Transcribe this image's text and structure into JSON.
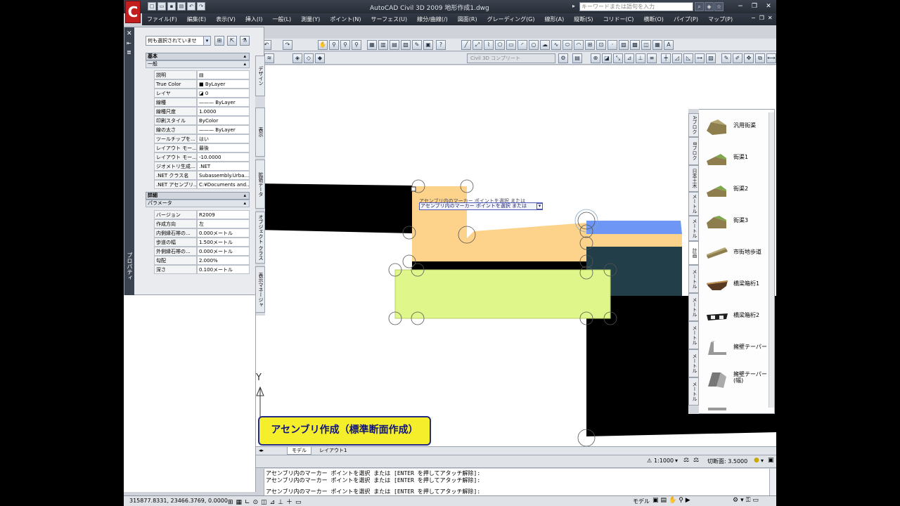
{
  "app": {
    "title": "AutoCAD Civil 3D 2009   地形作成1.dwg",
    "logo": "C",
    "search_placeholder": "キーワードまたは語句を入力",
    "window_buttons": [
      "−",
      "❐",
      "✕"
    ],
    "doc_buttons": [
      "−",
      "❐",
      "✕"
    ]
  },
  "menu": [
    "ファイル(F)",
    "編集(E)",
    "表示(V)",
    "挿入(I)",
    "一般(L)",
    "測量(Y)",
    "ポイント(N)",
    "サーフェス(U)",
    "線分/曲線(/)",
    "図面(R)",
    "グレーディング(G)",
    "線形(A)",
    "縦断(S)",
    "コリドー(C)",
    "横断(O)",
    "パイプ(P)",
    "マップ(P)"
  ],
  "toolbar": {
    "workspace": "Civil 3D コンプリート"
  },
  "properties": {
    "selection": "何も選択されていませ",
    "section_basic": "基本",
    "sub_general": "一般",
    "general_rows": [
      {
        "k": "説明",
        "v": ""
      },
      {
        "k": "True Color",
        "v": "ByLayer"
      },
      {
        "k": "レイヤ",
        "v": "0"
      },
      {
        "k": "線種",
        "v": "ByLayer"
      },
      {
        "k": "線種尺度",
        "v": "1.0000"
      },
      {
        "k": "印刷スタイル",
        "v": "ByColor"
      },
      {
        "k": "線の太さ",
        "v": "ByLayer"
      },
      {
        "k": "ツールチップを...",
        "v": "はい"
      },
      {
        "k": "レイアウト モー...",
        "v": "最後"
      },
      {
        "k": "レイアウト モー...",
        "v": "-10.0000"
      },
      {
        "k": "ジオメトリ生成...",
        "v": ".NET"
      },
      {
        "k": ".NET クラス名",
        "v": "Subassembly.Urba..."
      },
      {
        "k": ".NET アセンブリ...",
        "v": "C:¥Documents and..."
      }
    ],
    "section_detail": "詳細",
    "sub_params": "パラメータ",
    "param_rows": [
      {
        "k": "バージョン",
        "v": "R2009"
      },
      {
        "k": "作成方向",
        "v": "左"
      },
      {
        "k": "内側縁石帯の...",
        "v": "0.000メートル"
      },
      {
        "k": "歩道の幅",
        "v": "1.500メートル"
      },
      {
        "k": "外側縁石帯の...",
        "v": "0.000メートル"
      },
      {
        "k": "勾配",
        "v": "2.000%"
      },
      {
        "k": "深さ",
        "v": "0.100メートル"
      }
    ],
    "strip_label": "プロパティ",
    "side_tabs": [
      "デザイン",
      "表示",
      "拡張データ",
      "オブジェクト クラス",
      "表示マネージャ"
    ]
  },
  "tool_palette": {
    "tabs": [
      "Aブロク",
      "Bブロク",
      "日本土木",
      "メートル",
      "メートル",
      "計画",
      "メートル",
      "メートル",
      "メートル",
      "メートル",
      "メートル"
    ],
    "items": [
      "汎用街渠",
      "街渠1",
      "街渠2",
      "街渠3",
      "市街地歩道",
      "橋梁箱桁1",
      "橋梁箱桁2",
      "擁壁テーパー",
      "擁壁テーパー(幅)"
    ],
    "colors": {
      "curb_gray": "#8e7e4e",
      "curb_green": "#7fa84b",
      "bridge": "#5a3a20"
    }
  },
  "canvas": {
    "tooltip": "アセンブリ内のマーカー ポイントを選択 または",
    "tooltip_shadow": "アセンブリ内のマーカー ポイントを選択 または",
    "axis_y": "Y",
    "colors": {
      "black_fill": "#000000",
      "orange_fill": "#fdd28a",
      "green_fill": "#dff78a",
      "blue_fill": "#6e96f5",
      "teal_fill": "#223e48"
    }
  },
  "caption": "アセンブリ作成（標準断面作成）",
  "layout_tabs": [
    "モデル",
    "レイアウト1"
  ],
  "annotation": {
    "scale": "1:1000",
    "cut_label": "切断面: 3.5000"
  },
  "command_lines": [
    "アセンブリ内のマーカー ポイントを選択 または [ENTER を押してアタッチ解除]:",
    "アセンブリ内のマーカー ポイントを選択 または [ENTER を押してアタッチ解除]:",
    "アセンブリ内のマーカー ポイントを選択 または [ENTER を押してアタッチ解除]:"
  ],
  "status": {
    "coords": "315877.8331, 23466.3769, 0.0000",
    "model": "モデル"
  }
}
